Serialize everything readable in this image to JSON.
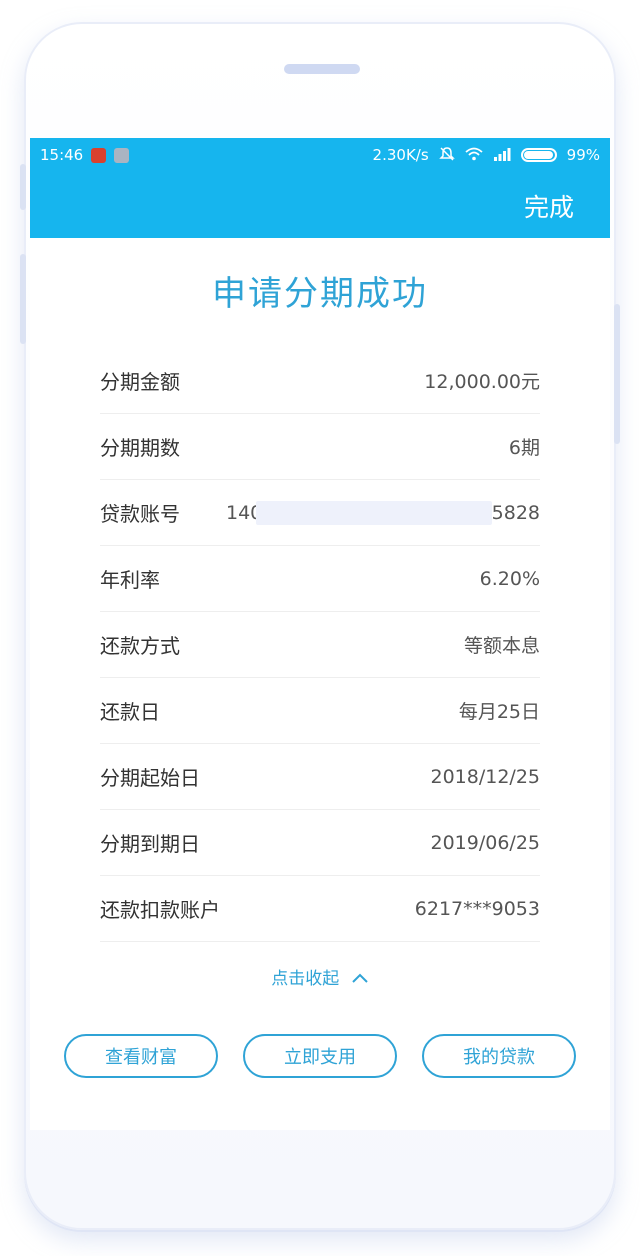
{
  "status_bar": {
    "time": "15:46",
    "net_speed": "2.30K/s",
    "battery_pct": "99%",
    "battery_level": 0.99,
    "icons": [
      "notification-red-icon",
      "notification-grey-icon",
      "mute-icon",
      "wifi-icon",
      "signal-icon",
      "battery-icon"
    ]
  },
  "header": {
    "done_label": "完成",
    "bar_color": "#16b5ee"
  },
  "title": "申请分期成功",
  "details": [
    {
      "label": "分期金额",
      "value": "12,000.00元"
    },
    {
      "label": "分期期数",
      "value": "6期"
    },
    {
      "label": "贷款账号",
      "value_start": "140",
      "value_end": "5828"
    },
    {
      "label": "年利率",
      "value": "6.20%"
    },
    {
      "label": "还款方式",
      "value": "等额本息"
    },
    {
      "label": "还款日",
      "value": "每月25日"
    },
    {
      "label": "分期起始日",
      "value": "2018/12/25"
    },
    {
      "label": "分期到期日",
      "value": "2019/06/25"
    },
    {
      "label": "还款扣款账户",
      "value": "6217***9053"
    }
  ],
  "collapse_label": "点击收起",
  "buttons": {
    "wealth": "查看财富",
    "use_now": "立即支用",
    "my_loans": "我的贷款"
  },
  "accent_color": "#2fa3d6"
}
